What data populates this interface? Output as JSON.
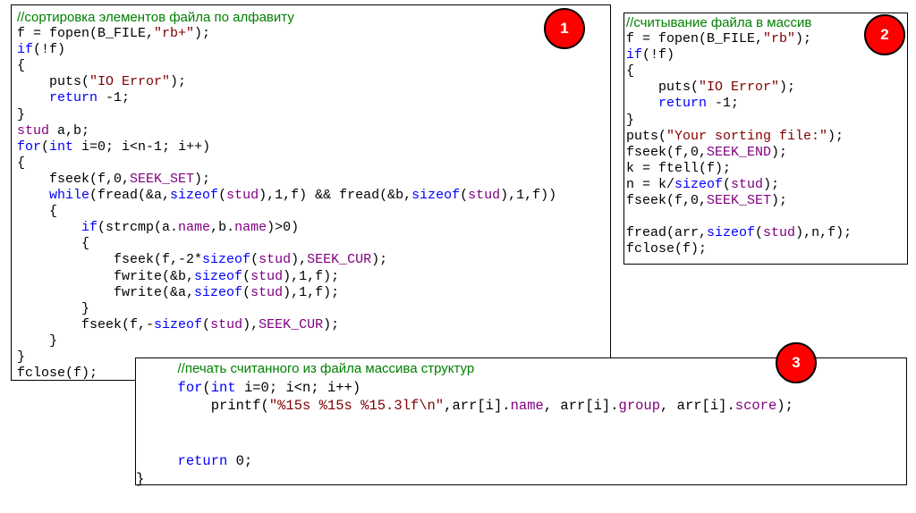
{
  "boxes": [
    {
      "badge": "1",
      "lines": [
        [
          {
            "t": "//сортировка элементов файла по алфавиту",
            "c": "cmt"
          }
        ],
        [
          {
            "t": "f = fopen(B_FILE,"
          },
          {
            "t": "\"rb+\"",
            "c": "str"
          },
          {
            "t": ");"
          }
        ],
        [
          {
            "t": "if",
            "c": "kw"
          },
          {
            "t": "(!f)"
          }
        ],
        [
          {
            "t": "{"
          }
        ],
        [
          {
            "t": "    puts("
          },
          {
            "t": "\"IO Error\"",
            "c": "str"
          },
          {
            "t": ");"
          }
        ],
        [
          {
            "t": "    "
          },
          {
            "t": "return",
            "c": "kw"
          },
          {
            "t": " -1;"
          }
        ],
        [
          {
            "t": "}"
          }
        ],
        [
          {
            "t": "stud",
            "c": "ty"
          },
          {
            "t": " a,b;"
          }
        ],
        [
          {
            "t": "for",
            "c": "kw"
          },
          {
            "t": "("
          },
          {
            "t": "int",
            "c": "kw"
          },
          {
            "t": " i=0; i<n-1; i++)"
          }
        ],
        [
          {
            "t": "{"
          }
        ],
        [
          {
            "t": "    fseek(f,0,"
          },
          {
            "t": "SEEK_SET",
            "c": "ty"
          },
          {
            "t": ");"
          }
        ],
        [
          {
            "t": "    "
          },
          {
            "t": "while",
            "c": "kw"
          },
          {
            "t": "(fread(&a,"
          },
          {
            "t": "sizeof",
            "c": "kw"
          },
          {
            "t": "("
          },
          {
            "t": "stud",
            "c": "ty"
          },
          {
            "t": "),1,f) && fread(&b,"
          },
          {
            "t": "sizeof",
            "c": "kw"
          },
          {
            "t": "("
          },
          {
            "t": "stud",
            "c": "ty"
          },
          {
            "t": "),1,f))"
          }
        ],
        [
          {
            "t": "    {"
          }
        ],
        [
          {
            "t": "        "
          },
          {
            "t": "if",
            "c": "kw"
          },
          {
            "t": "(strcmp(a."
          },
          {
            "t": "name",
            "c": "ty"
          },
          {
            "t": ",b."
          },
          {
            "t": "name",
            "c": "ty"
          },
          {
            "t": ")>0)"
          }
        ],
        [
          {
            "t": "        {"
          }
        ],
        [
          {
            "t": "            fseek(f,-2*"
          },
          {
            "t": "sizeof",
            "c": "kw"
          },
          {
            "t": "("
          },
          {
            "t": "stud",
            "c": "ty"
          },
          {
            "t": "),"
          },
          {
            "t": "SEEK_CUR",
            "c": "ty"
          },
          {
            "t": ");"
          }
        ],
        [
          {
            "t": "            fwrite(&b,"
          },
          {
            "t": "sizeof",
            "c": "kw"
          },
          {
            "t": "("
          },
          {
            "t": "stud",
            "c": "ty"
          },
          {
            "t": "),1,f);"
          }
        ],
        [
          {
            "t": "            fwrite(&a,"
          },
          {
            "t": "sizeof",
            "c": "kw"
          },
          {
            "t": "("
          },
          {
            "t": "stud",
            "c": "ty"
          },
          {
            "t": "),1,f);"
          }
        ],
        [
          {
            "t": "        }"
          }
        ],
        [
          {
            "t": "        fseek(f,-"
          },
          {
            "t": "sizeof",
            "c": "kw"
          },
          {
            "t": "("
          },
          {
            "t": "stud",
            "c": "ty"
          },
          {
            "t": "),"
          },
          {
            "t": "SEEK_CUR",
            "c": "ty"
          },
          {
            "t": ");"
          }
        ],
        [
          {
            "t": "    }"
          }
        ],
        [
          {
            "t": "}"
          }
        ],
        [
          {
            "t": "fclose(f);"
          }
        ]
      ]
    },
    {
      "badge": "2",
      "lines": [
        [
          {
            "t": "//считывание файла в массив",
            "c": "cmt"
          }
        ],
        [
          {
            "t": "f = fopen(B_FILE,"
          },
          {
            "t": "\"rb\"",
            "c": "str"
          },
          {
            "t": ");"
          }
        ],
        [
          {
            "t": "if",
            "c": "kw"
          },
          {
            "t": "(!f)"
          }
        ],
        [
          {
            "t": "{"
          }
        ],
        [
          {
            "t": "    puts("
          },
          {
            "t": "\"IO Error\"",
            "c": "str"
          },
          {
            "t": ");"
          }
        ],
        [
          {
            "t": "    "
          },
          {
            "t": "return",
            "c": "kw"
          },
          {
            "t": " -1;"
          }
        ],
        [
          {
            "t": "}"
          }
        ],
        [
          {
            "t": "puts("
          },
          {
            "t": "\"Your sorting file:\"",
            "c": "str"
          },
          {
            "t": ");"
          }
        ],
        [
          {
            "t": "fseek(f,0,"
          },
          {
            "t": "SEEK_END",
            "c": "ty"
          },
          {
            "t": ");"
          }
        ],
        [
          {
            "t": "k = ftell(f);"
          }
        ],
        [
          {
            "t": "n = k/"
          },
          {
            "t": "sizeof",
            "c": "kw"
          },
          {
            "t": "("
          },
          {
            "t": "stud",
            "c": "ty"
          },
          {
            "t": ");"
          }
        ],
        [
          {
            "t": "fseek(f,0,"
          },
          {
            "t": "SEEK_SET",
            "c": "ty"
          },
          {
            "t": ");"
          }
        ],
        [
          {
            "t": ""
          }
        ],
        [
          {
            "t": "fread(arr,"
          },
          {
            "t": "sizeof",
            "c": "kw"
          },
          {
            "t": "("
          },
          {
            "t": "stud",
            "c": "ty"
          },
          {
            "t": "),n,f);"
          }
        ],
        [
          {
            "t": "fclose(f);"
          }
        ]
      ]
    },
    {
      "badge": "3",
      "lines": [
        [
          {
            "t": "     "
          },
          {
            "t": "//печать считанного из файла массива структур",
            "c": "cmt"
          }
        ],
        [
          {
            "t": "     "
          },
          {
            "t": "for",
            "c": "kw"
          },
          {
            "t": "("
          },
          {
            "t": "int",
            "c": "kw"
          },
          {
            "t": " i=0; i<n; i++)"
          }
        ],
        [
          {
            "t": "         printf("
          },
          {
            "t": "\"%15s %15s %15.3lf\\n\"",
            "c": "str"
          },
          {
            "t": ",arr[i]."
          },
          {
            "t": "name",
            "c": "ty"
          },
          {
            "t": ", arr[i]."
          },
          {
            "t": "group",
            "c": "ty"
          },
          {
            "t": ", arr[i]."
          },
          {
            "t": "score",
            "c": "ty"
          },
          {
            "t": ");"
          }
        ],
        [
          {
            "t": ""
          }
        ],
        [
          {
            "t": ""
          }
        ],
        [
          {
            "t": "     "
          },
          {
            "t": "return",
            "c": "kw"
          },
          {
            "t": " 0;"
          }
        ],
        [
          {
            "t": "}"
          }
        ]
      ]
    }
  ]
}
